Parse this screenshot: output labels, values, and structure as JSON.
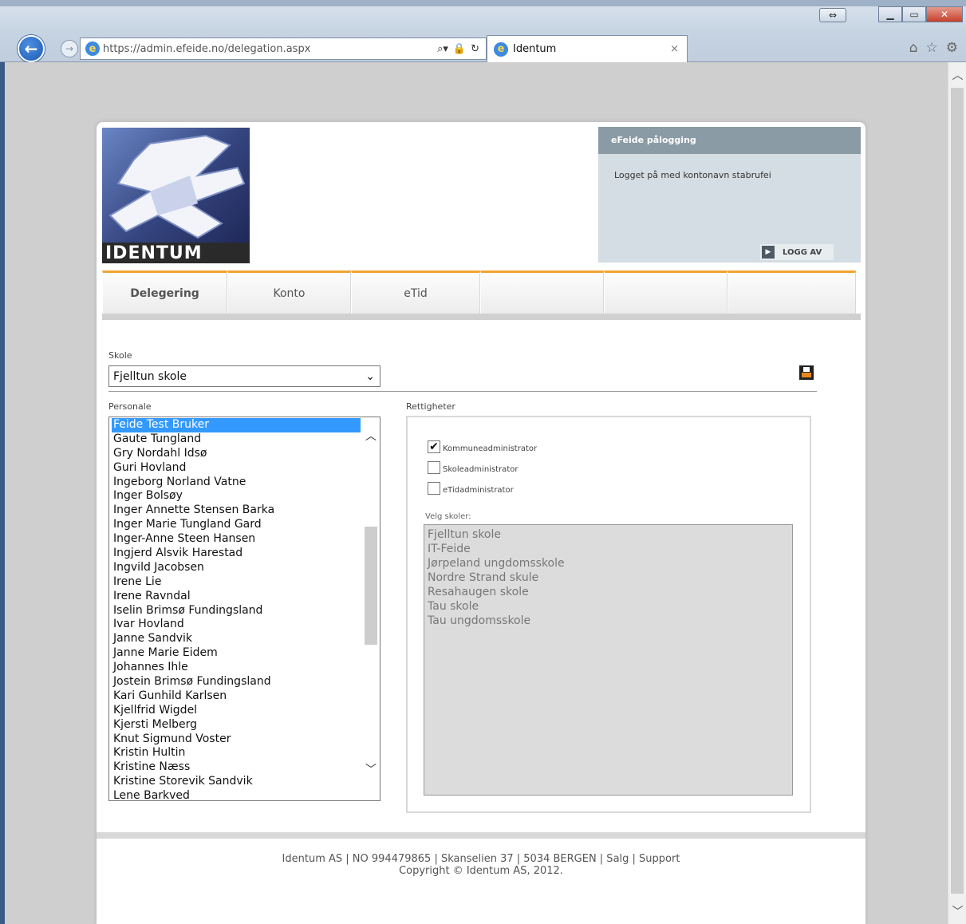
{
  "browser": {
    "url": "https://admin.efeide.no/delegation.aspx",
    "tab_title": "Identum",
    "tab_close": "×"
  },
  "login": {
    "header": "eFeide pålogging",
    "message": "Logget på med kontonavn stabrufei",
    "logout_label": "LOGG AV"
  },
  "logo": {
    "text": "IDENTUM"
  },
  "menu": {
    "items": [
      "Delegering",
      "Konto",
      "eTid",
      "",
      "",
      ""
    ]
  },
  "form": {
    "school_label": "Skole",
    "school_value": "Fjelltun skole",
    "staff_label": "Personale",
    "rights_label": "Rettigheter",
    "select_schools_label": "Velg skoler:"
  },
  "staff": [
    "Feide Test Bruker",
    "Gaute Tungland",
    "Gry Nordahl Idsø",
    "Guri Hovland",
    "Ingeborg Norland Vatne",
    "Inger Bolsøy",
    "Inger Annette Stensen Barka",
    "Inger Marie Tungland Gard",
    "Inger-Anne Steen Hansen",
    "Ingjerd Alsvik Harestad",
    "Ingvild Jacobsen",
    "Irene Lie",
    "Irene Ravndal",
    "Iselin Brimsø Fundingsland",
    "Ivar Hovland",
    "Janne Sandvik",
    "Janne Marie Eidem",
    "Johannes Ihle",
    "Jostein Brimsø Fundingsland",
    "Kari Gunhild Karlsen",
    "Kjellfrid Wigdel",
    "Kjersti Melberg",
    "Knut Sigmund Voster",
    "Kristin Hultin",
    "Kristine Næss",
    "Kristine Storevik Sandvik",
    "Lene Barkved"
  ],
  "selected_staff": "Feide Test Bruker",
  "rights": [
    {
      "label": "Kommuneadministrator",
      "checked": true
    },
    {
      "label": "Skoleadministrator",
      "checked": false
    },
    {
      "label": "eTidadministrator",
      "checked": false
    }
  ],
  "schools": [
    "Fjelltun skole",
    "IT-Feide",
    "Jørpeland ungdomsskole",
    "Nordre Strand skule",
    "Resahaugen skole",
    "Tau skole",
    "Tau ungdomsskole"
  ],
  "footer": {
    "line1": "Identum AS | NO 994479865 | Skanselien 37 | 5034 BERGEN | Salg | Support",
    "line2": "Copyright © Identum AS, 2012."
  }
}
